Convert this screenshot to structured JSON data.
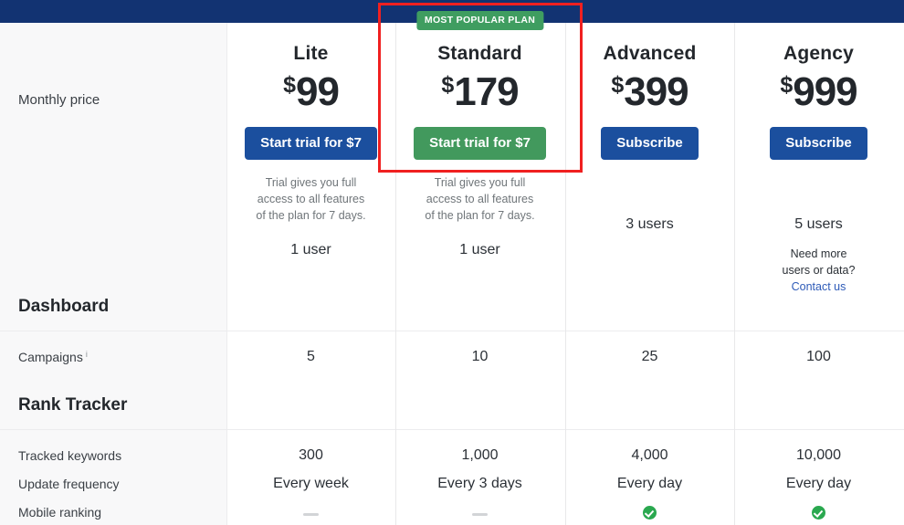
{
  "theme": {
    "header_bar": "#123372",
    "primary_blue": "#1b4f9e",
    "accent_green": "#42995d",
    "badge_green": "#3f9d60",
    "check_green": "#2aa84f",
    "highlight_red": "#f02020",
    "link_blue": "#2e5bb8"
  },
  "labels": {
    "monthly_price": "Monthly price",
    "badge_most_popular": "MOST POPULAR PLAN",
    "need_more": "Need more",
    "users_or_data": "users or data?",
    "contact_us": "Contact us",
    "info_icon": "i"
  },
  "sections": [
    {
      "title": "Dashboard"
    },
    {
      "title": "Rank Tracker"
    }
  ],
  "features": [
    {
      "label": "Campaigns",
      "has_info": true
    },
    {
      "label": "Tracked keywords",
      "has_info": false
    },
    {
      "label": "Update frequency",
      "has_info": false
    },
    {
      "label": "Mobile ranking",
      "has_info": false
    }
  ],
  "plans": [
    {
      "name": "Lite",
      "currency": "$",
      "price": "99",
      "cta_label": "Start trial for $7",
      "cta_style": "blue",
      "trial_note": "Trial gives you full access to all features of the plan for 7 days.",
      "users": "1 user",
      "most_popular": false,
      "highlighted": false,
      "needs_more_block": false,
      "values": {
        "campaigns": "5",
        "tracked_keywords": "300",
        "update_frequency": "Every week",
        "mobile_ranking": "dash"
      }
    },
    {
      "name": "Standard",
      "currency": "$",
      "price": "179",
      "cta_label": "Start trial for $7",
      "cta_style": "green",
      "trial_note": "Trial gives you full access to all features of the plan for 7 days.",
      "users": "1 user",
      "most_popular": true,
      "highlighted": true,
      "needs_more_block": false,
      "values": {
        "campaigns": "10",
        "tracked_keywords": "1,000",
        "update_frequency": "Every 3 days",
        "mobile_ranking": "dash"
      }
    },
    {
      "name": "Advanced",
      "currency": "$",
      "price": "399",
      "cta_label": "Subscribe",
      "cta_style": "blue",
      "trial_note": "",
      "users": "3 users",
      "most_popular": false,
      "highlighted": false,
      "needs_more_block": false,
      "values": {
        "campaigns": "25",
        "tracked_keywords": "4,000",
        "update_frequency": "Every day",
        "mobile_ranking": "check"
      }
    },
    {
      "name": "Agency",
      "currency": "$",
      "price": "999",
      "cta_label": "Subscribe",
      "cta_style": "blue",
      "trial_note": "",
      "users": "5 users",
      "most_popular": false,
      "highlighted": false,
      "needs_more_block": true,
      "values": {
        "campaigns": "100",
        "tracked_keywords": "10,000",
        "update_frequency": "Every day",
        "mobile_ranking": "check"
      }
    }
  ]
}
